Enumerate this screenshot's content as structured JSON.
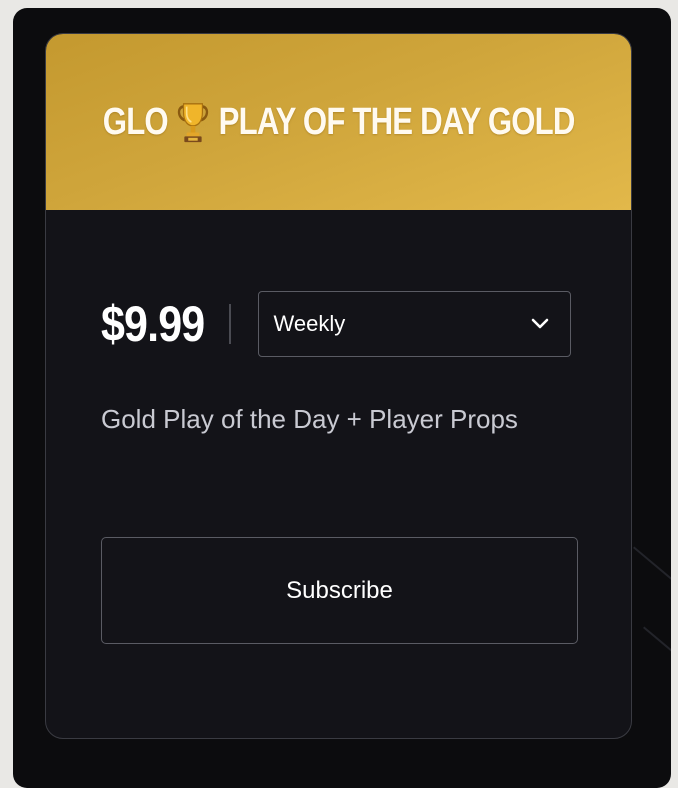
{
  "plan": {
    "title": "GLO 🏆 PLAY OF THE DAY GOLD",
    "title_prefix": "GLO",
    "title_suffix": "PLAY OF THE DAY GOLD",
    "title_icon": "trophy-icon",
    "price": "$9.99",
    "billing_period": {
      "selected": "Weekly"
    },
    "description": "Gold Play of the Day + Player Props",
    "subscribe_label": "Subscribe"
  },
  "colors": {
    "header_gold": "#cfa53b",
    "card_background": "#131318",
    "page_background": "#0c0c0e",
    "border": "#5a5b63",
    "text_primary": "#ffffff",
    "text_secondary": "#c9cad2"
  }
}
